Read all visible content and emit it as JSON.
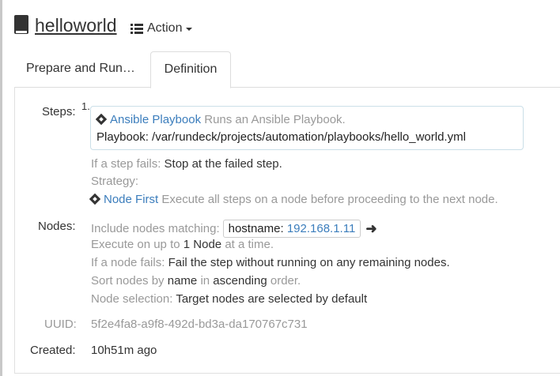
{
  "header": {
    "job_name": "helloworld",
    "action_label": "Action"
  },
  "tabs": [
    {
      "label": "Prepare and Run…",
      "active": false
    },
    {
      "label": "Definition",
      "active": true
    }
  ],
  "steps": {
    "label": "Steps:",
    "items": [
      {
        "number": "1.",
        "plugin_name": "Ansible Playbook",
        "description": "Runs an Ansible Playbook.",
        "config_label": "Playbook:",
        "config_value": "/var/rundeck/projects/automation/playbooks/hello_world.yml"
      }
    ],
    "error_handling_label": "If a step fails:",
    "error_handling_value": "Stop at the failed step.",
    "strategy_label": "Strategy:",
    "strategy_name": "Node First",
    "strategy_description": "Execute all steps on a node before proceeding to the next node."
  },
  "nodes": {
    "label": "Nodes:",
    "include_label": "Include nodes matching:",
    "filter_key": "hostname:",
    "filter_value": "192.168.1.11",
    "exec_prefix": "Execute on up to",
    "exec_count": "1",
    "exec_unit": "Node",
    "exec_suffix": "at a time.",
    "fail_label": "If a node fails:",
    "fail_value": "Fail the step without running on any remaining nodes.",
    "sort_prefix": "Sort nodes by",
    "sort_attr": "name",
    "sort_in": "in",
    "sort_dir": "ascending",
    "sort_suffix": "order.",
    "selection_label": "Node selection:",
    "selection_value": "Target nodes are selected by default"
  },
  "meta": {
    "uuid_label": "UUID:",
    "uuid_value": "5f2e4fa8-a9f8-492d-bd3a-da170767c731",
    "created_label": "Created:",
    "created_value": "10h51m ago"
  },
  "colors": {
    "link": "#3b7dbc",
    "muted": "#999999",
    "step_border": "#cbdfe8"
  }
}
